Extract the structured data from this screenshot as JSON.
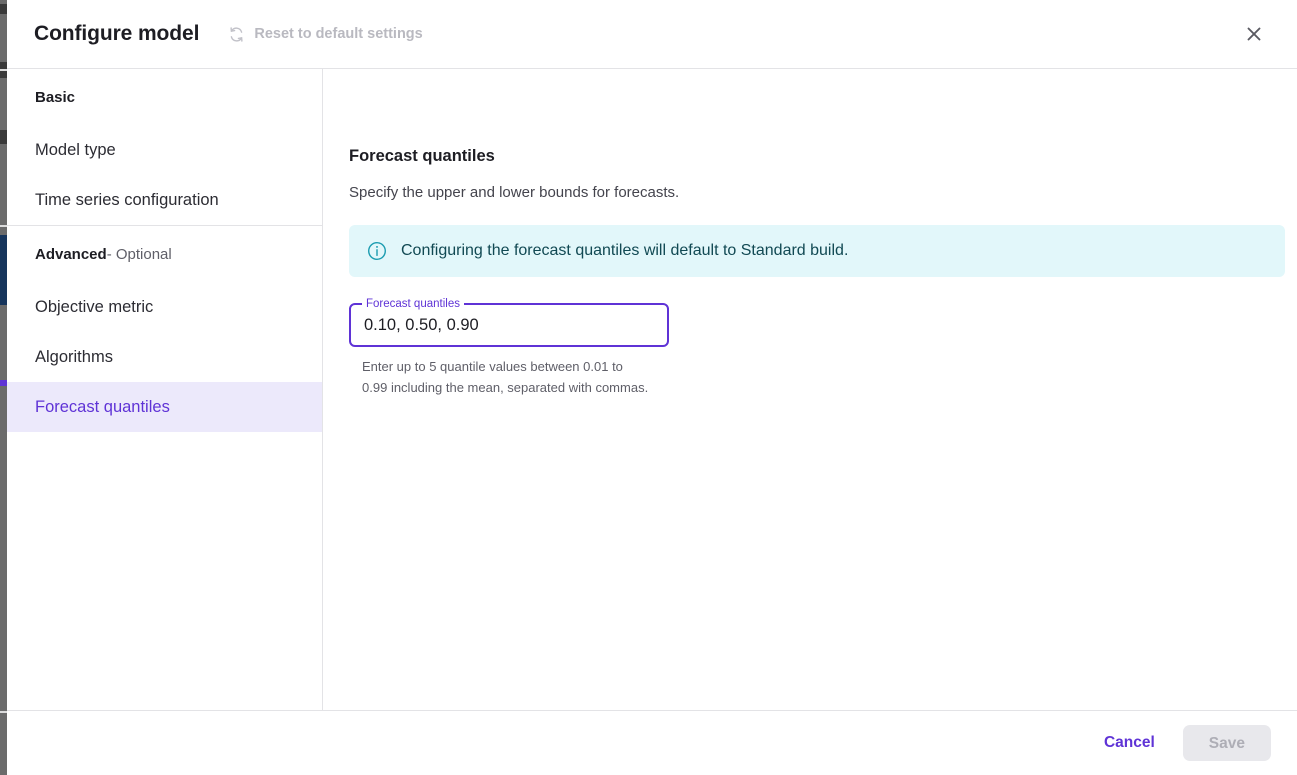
{
  "header": {
    "title": "Configure model",
    "reset_label": "Reset to default settings",
    "reset_icon": "refresh-icon",
    "close_icon": "close-icon"
  },
  "sidebar": {
    "sections": [
      {
        "heading": "Basic",
        "heading_suffix": "",
        "items": [
          {
            "label": "Model type",
            "selected": false
          },
          {
            "label": "Time series configuration",
            "selected": false
          }
        ]
      },
      {
        "heading": "Advanced",
        "heading_suffix": " - Optional",
        "items": [
          {
            "label": "Objective metric",
            "selected": false
          },
          {
            "label": "Algorithms",
            "selected": false
          },
          {
            "label": "Forecast quantiles",
            "selected": true
          }
        ]
      }
    ]
  },
  "content": {
    "title": "Forecast quantiles",
    "description": "Specify the upper and lower bounds for forecasts.",
    "banner": {
      "icon": "info-circle-icon",
      "text": "Configuring the forecast quantiles will default to Standard build."
    },
    "field": {
      "label": "Forecast quantiles",
      "value": "0.10, 0.50, 0.90",
      "placeholder": "",
      "help_line_1": "Enter up to 5 quantile values between 0.01 to 0.99",
      "help_line_2": "including the mean, separated with commas."
    }
  },
  "footer": {
    "cancel_label": "Cancel",
    "save_label": "Save"
  },
  "colors": {
    "accent": "#5f33d6",
    "selected_bg": "#ece9fb",
    "banner_bg": "#e2f7fa",
    "banner_fg": "#114953",
    "disabled_bg": "#e8e8ec",
    "disabled_fg": "#aeaeb6",
    "border": "#e3e3e6"
  }
}
